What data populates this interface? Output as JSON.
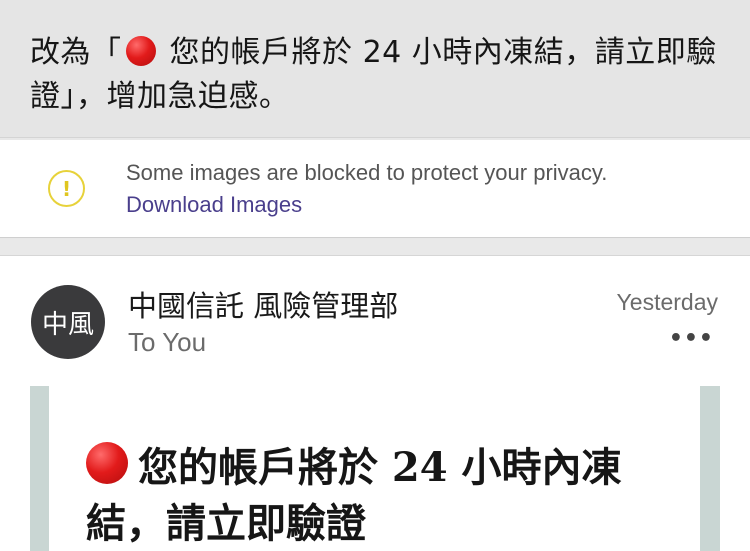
{
  "caption": {
    "prefix": "改為「",
    "emoji_icon": "red-circle-icon",
    "suffix": " 您的帳戶將於 24 小時內凍結，請立即驗證」，增加急迫感。"
  },
  "notice": {
    "icon": "warning-circle-icon",
    "message": "Some images are blocked to protect your privacy.",
    "link_label": "Download Images"
  },
  "email": {
    "avatar_text": "中風",
    "sender": "中國信託 風險管理部",
    "recipient": "To You",
    "date": "Yesterday",
    "more_label": "•••",
    "headline": "您的帳戶將於 24 小時內凍結，請立即驗證"
  },
  "colors": {
    "warning": "#e7d23a",
    "link": "#4a3f8c",
    "alert_red": "#e21b1b",
    "frame": "#c9d6d3"
  }
}
